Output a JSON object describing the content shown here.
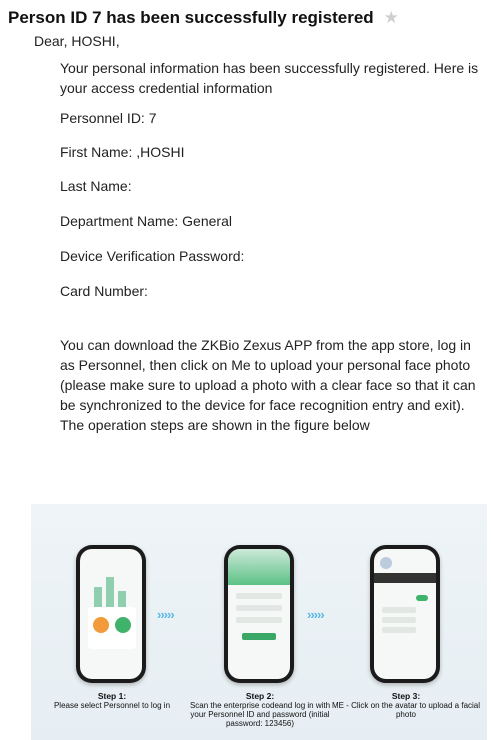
{
  "email": {
    "subject": "Person ID 7 has been successfully registered",
    "star_icon": "star-icon",
    "greeting": "Dear, HOSHI,",
    "intro": "Your personal information has been successfully registered. Here is your access credential information",
    "fields": [
      "Personnel ID: 7",
      "First Name: ,HOSHI",
      "Last Name:",
      "Department Name: General",
      "Device Verification Password:",
      "Card Number:"
    ],
    "instructions": "You can download the ZKBio Zexus APP from the app store, log in as Personnel, then click on Me to upload your personal face photo (please make sure to upload a photo with a clear face so that it can be synchronized to the device for face recognition entry and exit). The operation steps are shown in the figure below"
  },
  "banner": {
    "arrows": "›››››",
    "steps": [
      {
        "title": "Step 1:",
        "text": "Please select Personnel to log in"
      },
      {
        "title": "Step 2:",
        "text": "Scan the enterprise codeand log in with your Personnel ID and password (initial password: 123456)"
      },
      {
        "title": "Step 3:",
        "text": "ME - Click on the avatar to upload a facial photo"
      }
    ]
  },
  "colors": {
    "accent_green": "#3fb36b",
    "arrow_blue": "#57b8e6",
    "star": "#cfcfcf"
  }
}
